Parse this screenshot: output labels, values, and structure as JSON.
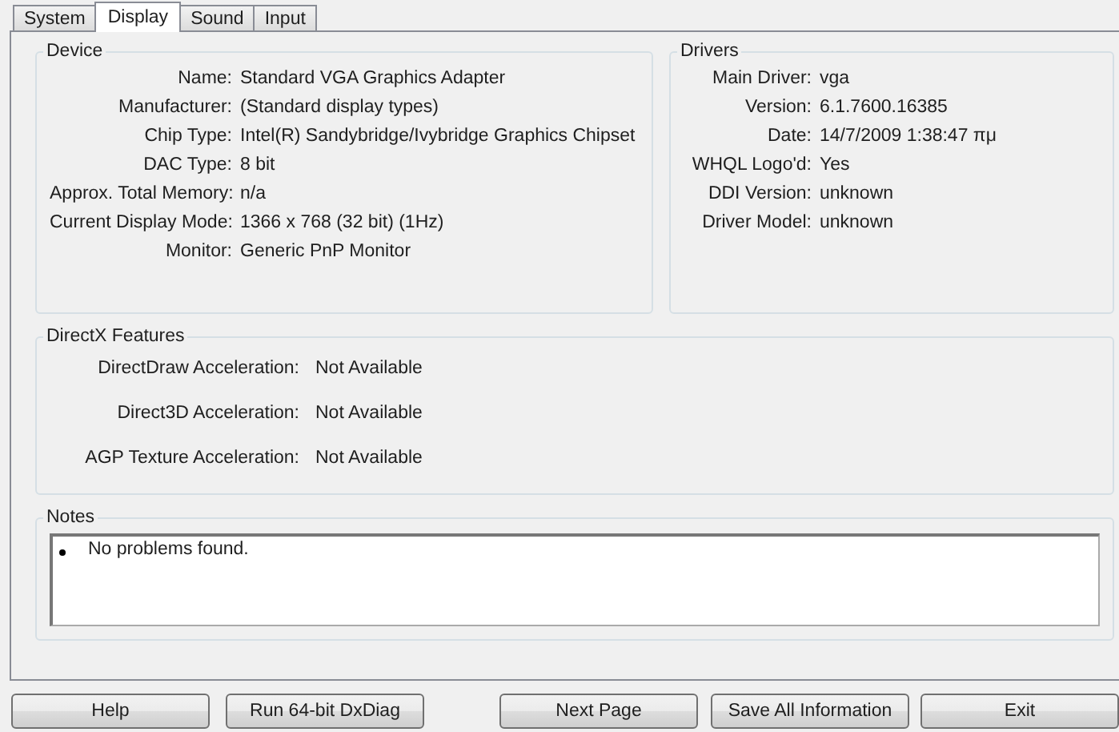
{
  "tabs": [
    {
      "label": "System",
      "selected": false
    },
    {
      "label": "Display",
      "selected": true
    },
    {
      "label": "Sound",
      "selected": false
    },
    {
      "label": "Input",
      "selected": false
    }
  ],
  "device": {
    "title": "Device",
    "fields": [
      {
        "label": "Name:",
        "value": "Standard VGA Graphics Adapter"
      },
      {
        "label": "Manufacturer:",
        "value": "(Standard display types)"
      },
      {
        "label": "Chip Type:",
        "value": "Intel(R) Sandybridge/Ivybridge Graphics Chipset"
      },
      {
        "label": "DAC Type:",
        "value": "8 bit"
      },
      {
        "label": "Approx. Total Memory:",
        "value": "n/a"
      },
      {
        "label": "Current Display Mode:",
        "value": "1366 x 768 (32 bit) (1Hz)"
      },
      {
        "label": "Monitor:",
        "value": "Generic PnP Monitor"
      }
    ]
  },
  "drivers": {
    "title": "Drivers",
    "fields": [
      {
        "label": "Main Driver:",
        "value": "vga"
      },
      {
        "label": "Version:",
        "value": "6.1.7600.16385"
      },
      {
        "label": "Date:",
        "value": "14/7/2009 1:38:47 πμ"
      },
      {
        "label": "WHQL Logo'd:",
        "value": "Yes"
      },
      {
        "label": "DDI Version:",
        "value": "unknown"
      },
      {
        "label": "Driver Model:",
        "value": "unknown"
      }
    ]
  },
  "directx_features": {
    "title": "DirectX Features",
    "fields": [
      {
        "label": "DirectDraw Acceleration:",
        "value": "Not Available"
      },
      {
        "label": "Direct3D Acceleration:",
        "value": "Not Available"
      },
      {
        "label": "AGP Texture Acceleration:",
        "value": "Not Available"
      }
    ]
  },
  "notes": {
    "title": "Notes",
    "items": [
      "No problems found."
    ]
  },
  "buttons": [
    "Help",
    "Run 64-bit DxDiag",
    "Next Page",
    "Save All Information",
    "Exit"
  ]
}
